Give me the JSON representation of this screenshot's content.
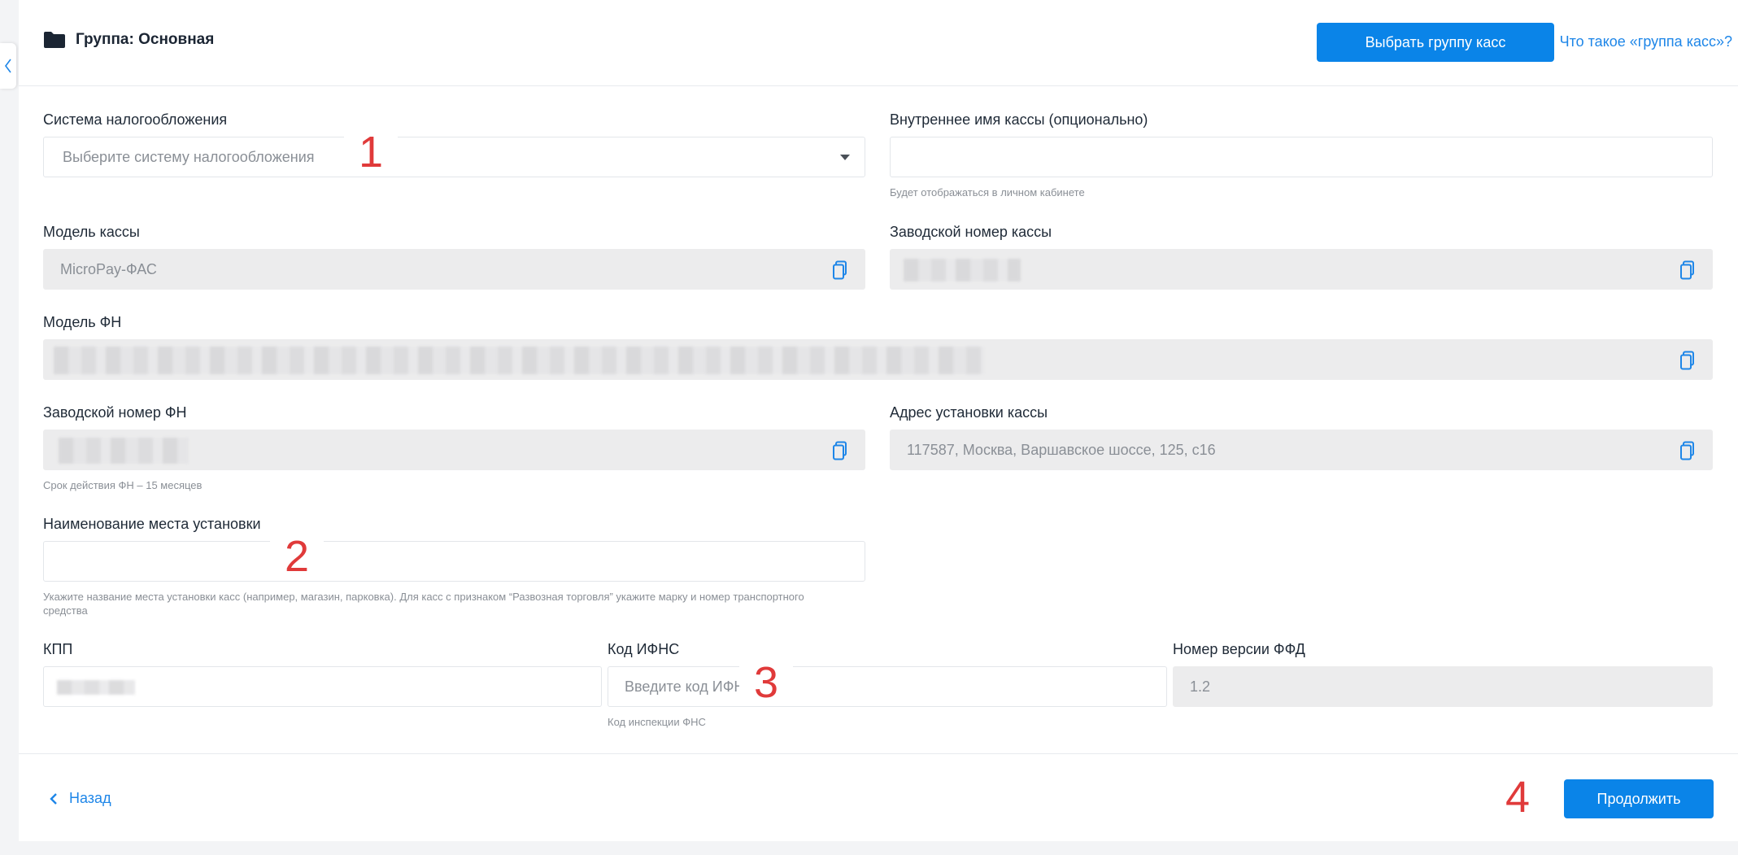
{
  "header": {
    "group_title": "Группа: Основная",
    "choose_group_button": "Выбрать группу касс",
    "help_link": "Что такое «группа касс»?"
  },
  "form": {
    "tax_system": {
      "label": "Система налогообложения",
      "placeholder": "Выберите систему налогообложения"
    },
    "internal_name": {
      "label": "Внутреннее имя кассы (опционально)",
      "value": "",
      "hint": "Будет отображаться в личном кабинете"
    },
    "register_model": {
      "label": "Модель кассы",
      "value": "MicroPay-ФАС"
    },
    "register_serial": {
      "label": "Заводской номер кассы"
    },
    "fn_model": {
      "label": "Модель ФН"
    },
    "fn_serial": {
      "label": "Заводской номер ФН",
      "hint": "Срок действия ФН – 15 месяцев"
    },
    "install_address": {
      "label": "Адрес установки кассы",
      "value": "117587, Москва, Варшавское шоссе, 125, с16"
    },
    "install_place": {
      "label": "Наименование места установки",
      "value": "",
      "hint": "Укажите название места установки касс (например, магазин, парковка). Для касс с признаком “Развозная торговля” укажите марку и номер транспортного средства"
    },
    "kpp": {
      "label": "КПП"
    },
    "ifns_code": {
      "label": "Код ИФНС",
      "placeholder": "Введите код ИФНС",
      "hint": "Код инспекции ФНС"
    },
    "ffd_version": {
      "label": "Номер версии ФФД",
      "value": "1.2"
    }
  },
  "markers": [
    "1",
    "2",
    "3",
    "4"
  ],
  "footer": {
    "back_label": "Назад",
    "continue_button": "Продолжить"
  },
  "colors": {
    "accent": "#0a84e8",
    "link": "#1e86e8",
    "marker": "#e03a3a",
    "readonly_bg": "#ececed"
  }
}
